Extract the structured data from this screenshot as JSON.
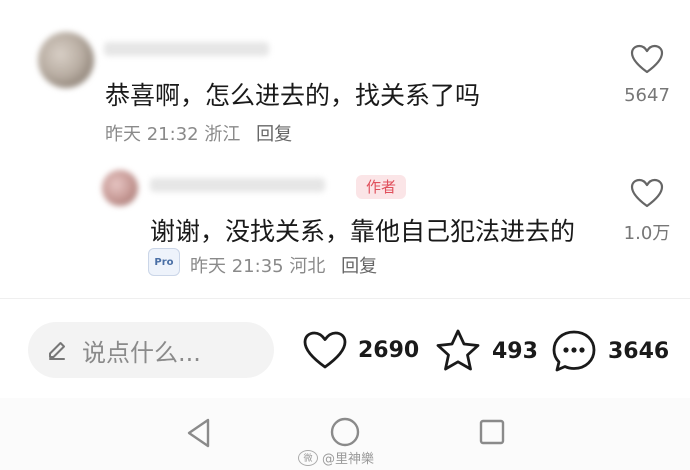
{
  "comments": [
    {
      "text": "恭喜啊，怎么进去的，找关系了吗",
      "date": "昨天 21:32",
      "location": "浙江",
      "reply_label": "回复",
      "likes": "5647"
    }
  ],
  "reply": {
    "author_badge": "作者",
    "text": "谢谢，没找关系，靠他自己犯法进去的",
    "date": "昨天 21:35",
    "location": "河北",
    "reply_label": "回复",
    "likes": "1.0万",
    "sticker_text": "Pro"
  },
  "bottom_bar": {
    "input_placeholder": "说点什么...",
    "like_count": "2690",
    "favorite_count": "493",
    "comment_count": "3646"
  },
  "watermark": {
    "platform_glyph": "微",
    "account": "@里神樂"
  },
  "icons": {
    "heart": "heart-icon",
    "star": "star-icon",
    "comment": "comment-bubble-icon",
    "pen": "pen-icon",
    "back": "nav-back-icon",
    "home": "nav-home-icon",
    "recents": "nav-recents-icon"
  },
  "colors": {
    "author_badge_bg": "#fbe5e7",
    "author_badge_text": "#e0505c",
    "meta_gray": "#8a8a8a"
  }
}
